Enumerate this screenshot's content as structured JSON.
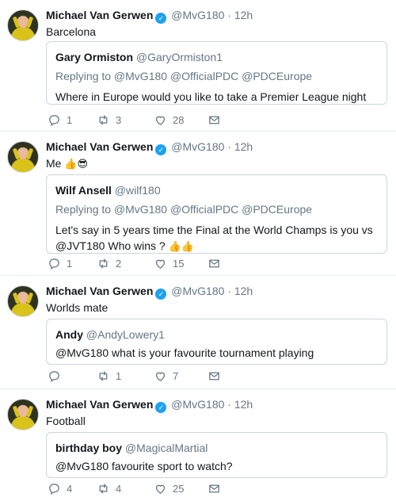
{
  "tweets": [
    {
      "author": "Michael Van Gerwen",
      "handle": "@MvG180",
      "dot": "·",
      "time": "12h",
      "text": "Barcelona",
      "emoji": "",
      "quote": {
        "name": "Gary Ormiston",
        "handle": "@GaryOrmiston1",
        "replying": "Replying to @MvG180 @OfficialPDC @PDCEurope",
        "text": "Where in Europe would you like to take a Premier League night",
        "emoji": ""
      },
      "replies": "1",
      "retweets": "3",
      "likes": "28"
    },
    {
      "author": "Michael Van Gerwen",
      "handle": "@MvG180",
      "dot": "·",
      "time": "12h",
      "text": "Me",
      "emoji": "👍😎",
      "quote": {
        "name": "Wilf Ansell",
        "handle": "@wilf180",
        "replying": "Replying to @MvG180 @OfficialPDC @PDCEurope",
        "text": "Let's say in 5 years time the Final at the World Champs is you vs @JVT180 Who wins ?",
        "emoji": "👍👍"
      },
      "replies": "1",
      "retweets": "2",
      "likes": "15"
    },
    {
      "author": "Michael Van Gerwen",
      "handle": "@MvG180",
      "dot": "·",
      "time": "12h",
      "text": "Worlds mate",
      "emoji": "",
      "quote": {
        "name": "Andy",
        "handle": "@AndyLowery1",
        "replying": "",
        "text": "@MvG180 what is your favourite tournament playing",
        "emoji": ""
      },
      "replies": "",
      "retweets": "1",
      "likes": "7"
    },
    {
      "author": "Michael Van Gerwen",
      "handle": "@MvG180",
      "dot": "·",
      "time": "12h",
      "text": "Football",
      "emoji": "",
      "quote": {
        "name": "birthday boy",
        "handle": "@MagicalMartial",
        "replying": "",
        "text": "@MvG180 favourite sport to watch?",
        "emoji": ""
      },
      "replies": "4",
      "retweets": "4",
      "likes": "25"
    }
  ],
  "icons": {
    "verified": "verified-badge-icon",
    "reply": "reply-icon",
    "retweet": "retweet-icon",
    "like": "heart-icon",
    "dm": "envelope-icon"
  },
  "colors": {
    "text": "#14171a",
    "muted": "#657786",
    "border": "#ccd6dd",
    "verified": "#1da1f2"
  }
}
